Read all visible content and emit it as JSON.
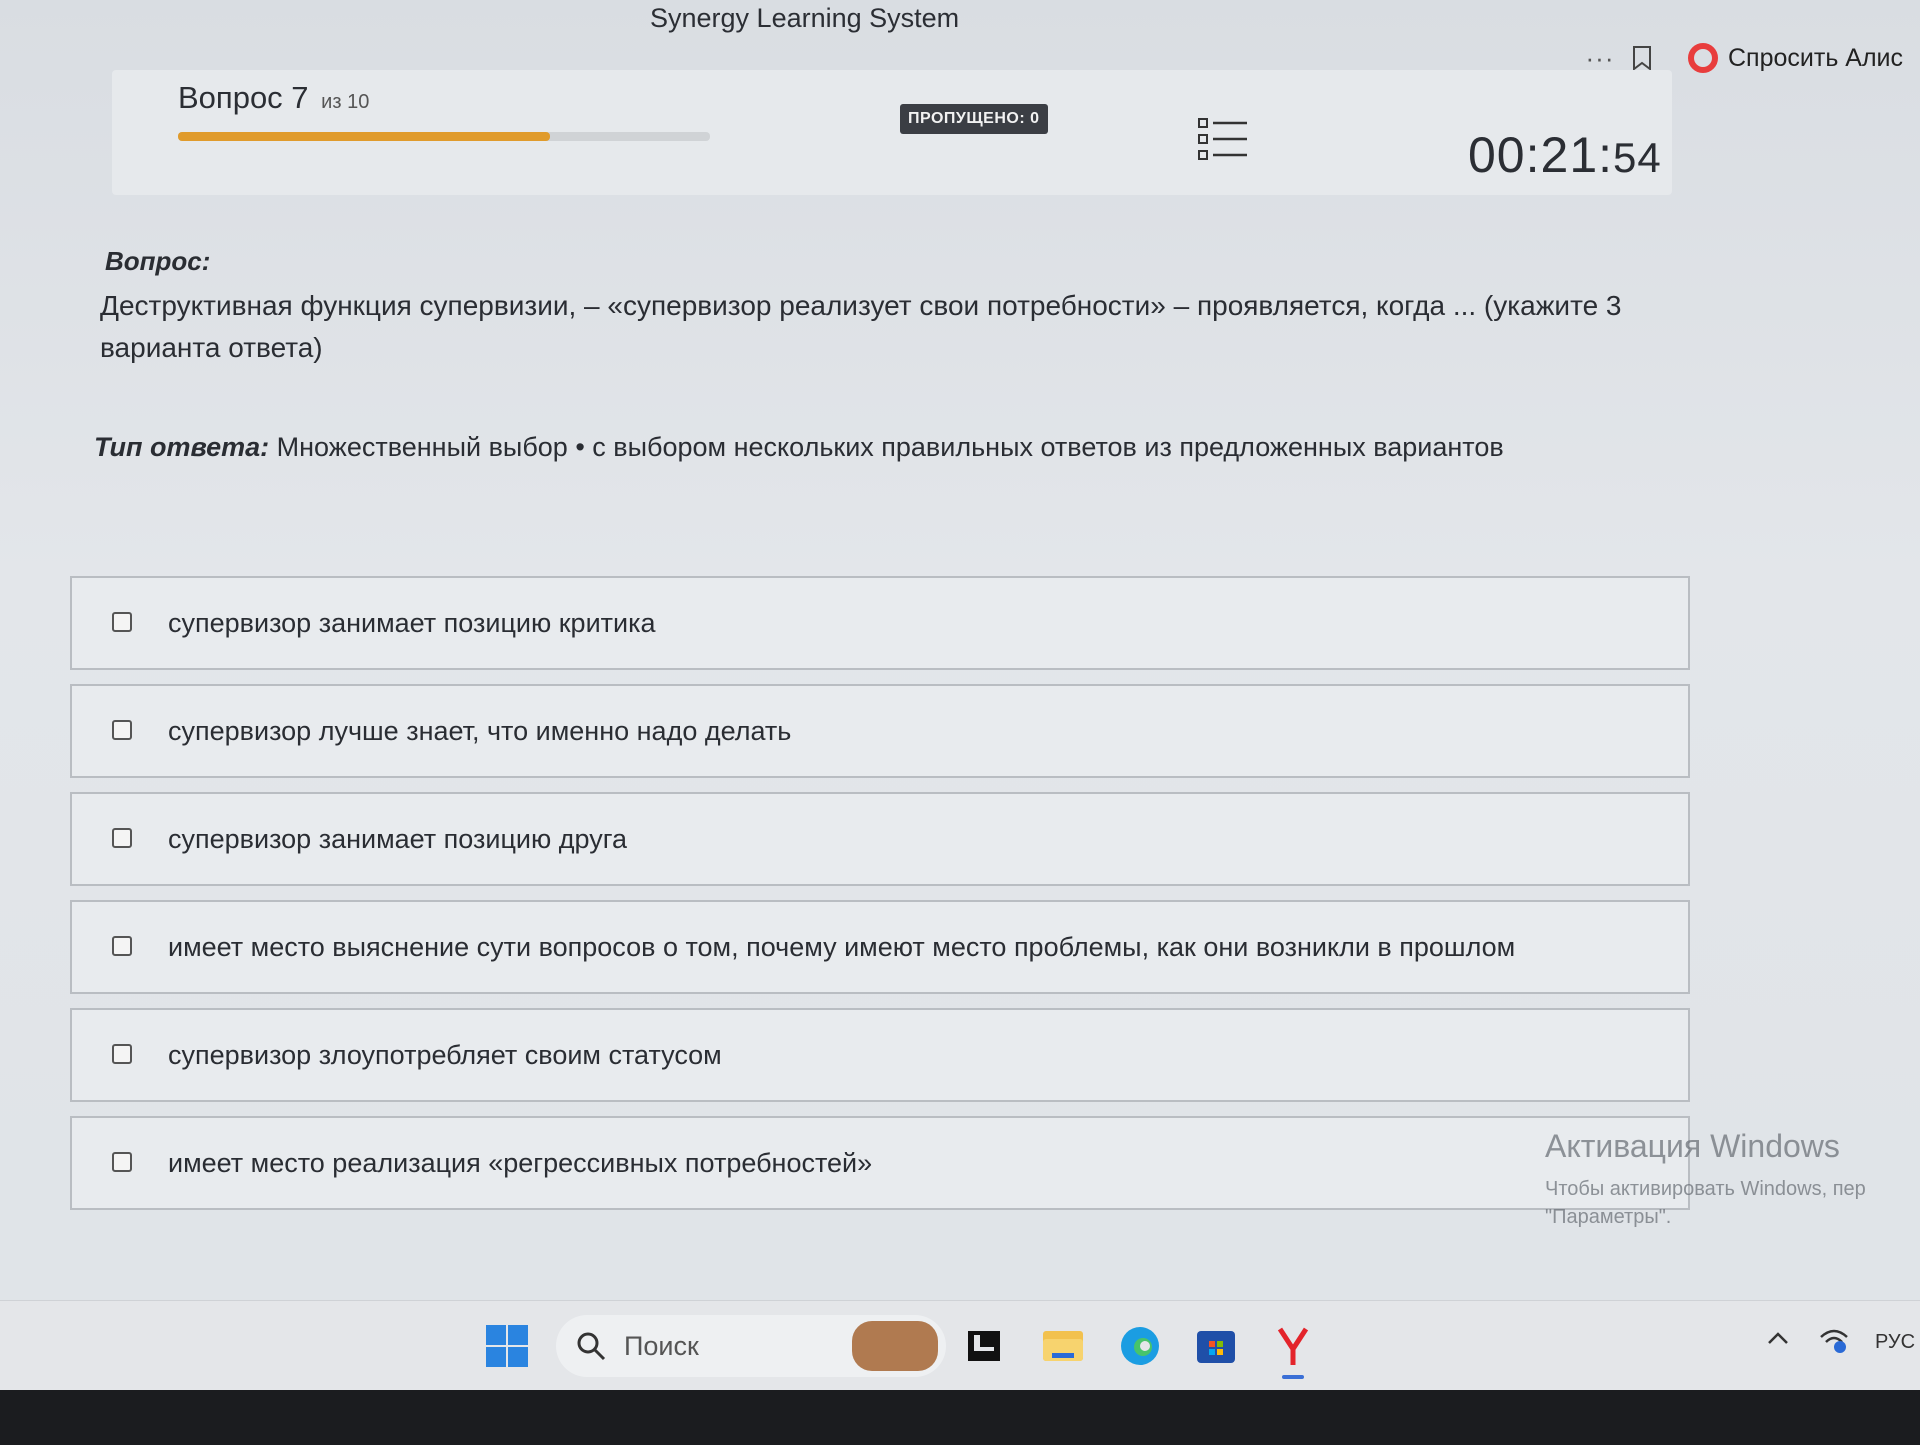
{
  "window": {
    "title": "Synergy Learning System"
  },
  "browser": {
    "more_label": "···",
    "alice_label": "Спросить Алис"
  },
  "header": {
    "question_label": "Вопрос 7",
    "question_total": "из 10",
    "progress_fraction": 0.7,
    "skipped_label": "ПРОПУЩЕНО: 0",
    "timer_main": "00:21:",
    "timer_seconds": "54"
  },
  "question": {
    "label": "Вопрос:",
    "text": "Деструктивная функция супервизии, – «супервизор реализует свои потребности» – проявляется, когда ... (укажите 3 варианта ответа)"
  },
  "answer_type": {
    "label": "Тип ответа:",
    "value": "Множественный выбор • с выбором нескольких правильных ответов из предложенных вариантов"
  },
  "options": [
    {
      "label": "супервизор занимает позицию критика",
      "checked": false
    },
    {
      "label": "супервизор лучше знает, что именно надо делать",
      "checked": false
    },
    {
      "label": "супервизор занимает позицию друга",
      "checked": false
    },
    {
      "label": "имеет место выяснение сути вопросов о том, почему имеют место проблемы, как они возникли в прошлом",
      "checked": false
    },
    {
      "label": "супервизор злоупотребляет своим статусом",
      "checked": false
    },
    {
      "label": "имеет место реализация «регрессивных потребностей»",
      "checked": false
    }
  ],
  "watermark": {
    "title": "Активация Windows",
    "line1": "Чтобы активировать Windows, пер",
    "line2": "\"Параметры\"."
  },
  "taskbar": {
    "search_placeholder": "Поиск",
    "language": "РУС",
    "icons": [
      "windows-start-icon",
      "search-icon",
      "news-widget-icon",
      "terminal-icon",
      "file-explorer-icon",
      "edge-icon",
      "store-icon",
      "yandex-browser-icon",
      "chevron-up-icon",
      "network-icon"
    ]
  }
}
